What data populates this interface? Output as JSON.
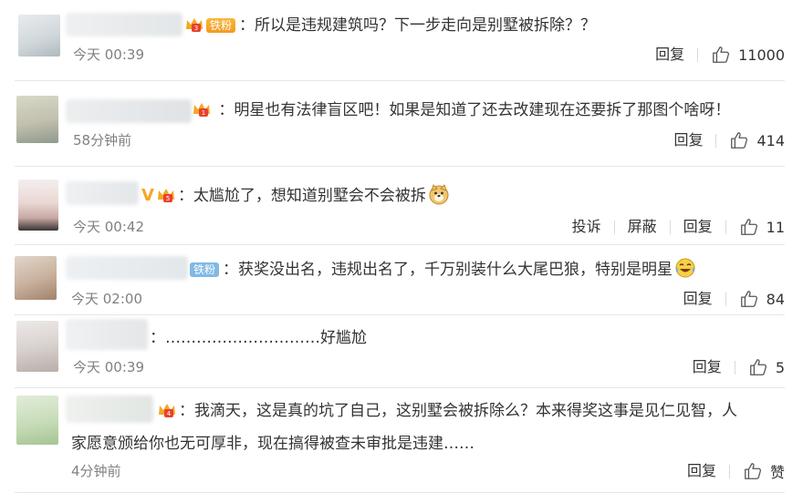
{
  "comments": [
    {
      "badge_fan": "铁粉",
      "text": "：所以是违规建筑吗？下一步走向是别墅被拆除？？",
      "time": "今天 00:39",
      "reply": "回复",
      "likes": "11000"
    },
    {
      "text": "：明星也有法律盲区吧！如果是知道了还去改建现在还要拆了那图个啥呀！",
      "time": "58分钟前",
      "reply": "回复",
      "likes": "414"
    },
    {
      "v_mark": "V",
      "text": "：太尴尬了，想知道别墅会不会被拆",
      "emoji": "doge-emoji",
      "time": "今天 00:42",
      "report": "投诉",
      "block": "屏蔽",
      "reply": "回复",
      "likes": "11"
    },
    {
      "badge_fan": "铁粉",
      "text": "：获奖没出名，违规出名了，千万别装什么大尾巴狼，特别是明星",
      "emoji": "laugh-cry-emoji",
      "time": "今天 02:00",
      "reply": "回复",
      "likes": "84"
    },
    {
      "text": "：…………………………好尴尬",
      "time": "今天 00:39",
      "reply": "回复",
      "likes": "5"
    },
    {
      "text_line1": "：我滴天，这是真的坑了自己，这别墅会被拆除么？本来得奖这事是见仁见智，人",
      "text_line2": "家愿意颁给你也无可厚非，现在搞得被查未审批是违建……",
      "time": "4分钟前",
      "reply": "回复",
      "likes": "赞"
    }
  ],
  "colors": {
    "time": "#808080",
    "fan_gold": "#f39a22",
    "fan_blue": "#80b9e5",
    "crown": "#f5a623"
  }
}
